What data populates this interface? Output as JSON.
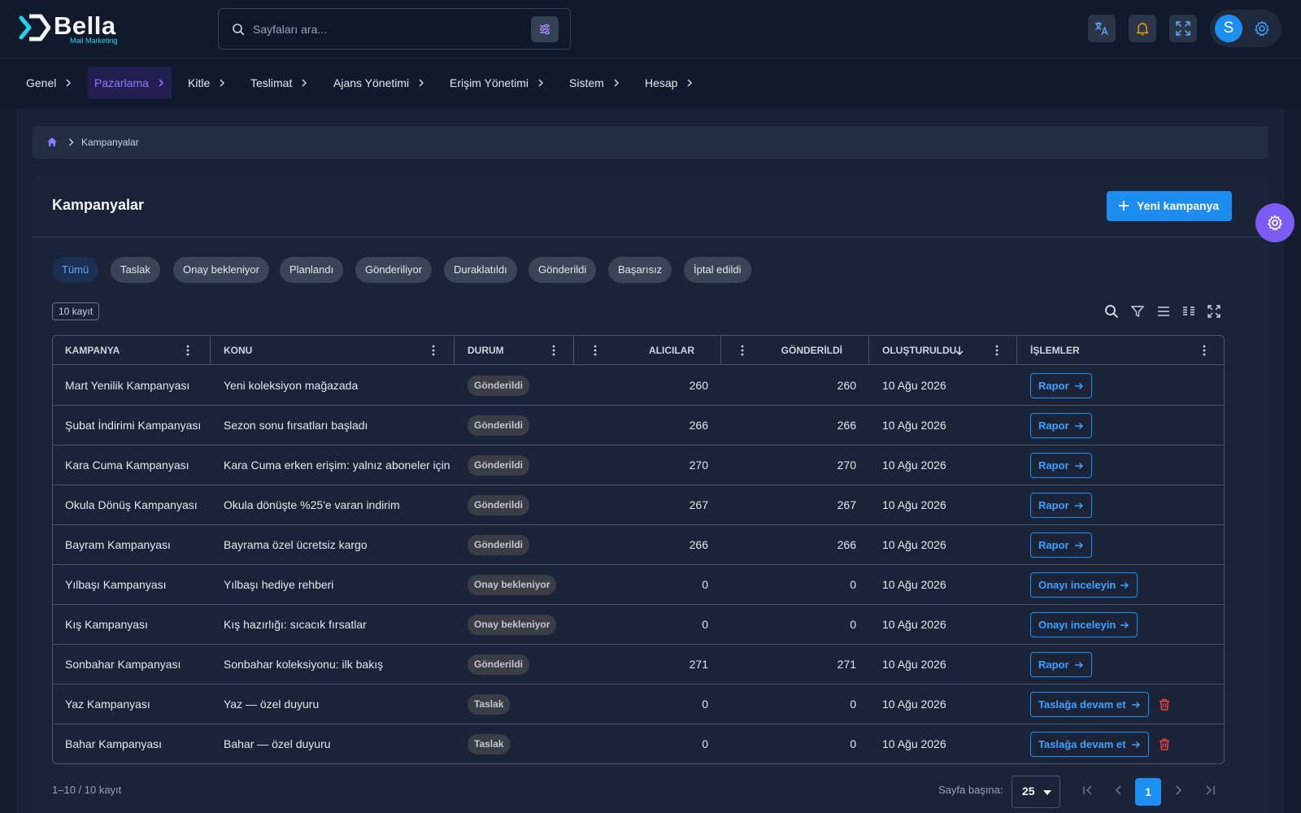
{
  "app": {
    "name": "Bella",
    "subtitle": "Mail Marketing"
  },
  "search": {
    "placeholder": "Sayfaları ara..."
  },
  "menu": [
    {
      "label": "Genel"
    },
    {
      "label": "Pazarlama",
      "active": true
    },
    {
      "label": "Kitle"
    },
    {
      "label": "Teslimat"
    },
    {
      "label": "Ajans Yönetimi"
    },
    {
      "label": "Erişim Yönetimi"
    },
    {
      "label": "Sistem"
    },
    {
      "label": "Hesap"
    }
  ],
  "user": {
    "initial": "S"
  },
  "breadcrumb": {
    "current": "Kampanyalar"
  },
  "page": {
    "title": "Kampanyalar",
    "new_button": "Yeni kampanya"
  },
  "filters": [
    "Tümü",
    "Taslak",
    "Onay bekleniyor",
    "Planlandı",
    "Gönderiliyor",
    "Duraklatıldı",
    "Gönderildi",
    "Başarısız",
    "İptal edildi"
  ],
  "active_filter": "Tümü",
  "record_count": "10 kayıt",
  "table": {
    "columns": [
      "KAMPANYA",
      "KONU",
      "DURUM",
      "ALICILAR",
      "GÖNDERİLDİ",
      "OLUŞTURULDU",
      "İŞLEMLER"
    ],
    "rows": [
      {
        "name": "Mart Yenilik Kampanyası",
        "subject": "Yeni koleksiyon mağazada",
        "status": "Gönderildi",
        "recipients": "260",
        "sent": "260",
        "created": "10 Ağu 2026",
        "action": "Rapor"
      },
      {
        "name": "Şubat İndirimi Kampanyası",
        "subject": "Sezon sonu fırsatları başladı",
        "status": "Gönderildi",
        "recipients": "266",
        "sent": "266",
        "created": "10 Ağu 2026",
        "action": "Rapor"
      },
      {
        "name": "Kara Cuma Kampanyası",
        "subject": "Kara Cuma erken erişim: yalnız aboneler için",
        "status": "Gönderildi",
        "recipients": "270",
        "sent": "270",
        "created": "10 Ağu 2026",
        "action": "Rapor"
      },
      {
        "name": "Okula Dönüş Kampanyası",
        "subject": "Okula dönüşte %25'e varan indirim",
        "status": "Gönderildi",
        "recipients": "267",
        "sent": "267",
        "created": "10 Ağu 2026",
        "action": "Rapor"
      },
      {
        "name": "Bayram Kampanyası",
        "subject": "Bayrama özel ücretsiz kargo",
        "status": "Gönderildi",
        "recipients": "266",
        "sent": "266",
        "created": "10 Ağu 2026",
        "action": "Rapor"
      },
      {
        "name": "Yılbaşı Kampanyası",
        "subject": "Yılbaşı hediye rehberi",
        "status": "Onay bekleniyor",
        "recipients": "0",
        "sent": "0",
        "created": "10 Ağu 2026",
        "action": "Onayı inceleyin"
      },
      {
        "name": "Kış Kampanyası",
        "subject": "Kış hazırlığı: sıcacık fırsatlar",
        "status": "Onay bekleniyor",
        "recipients": "0",
        "sent": "0",
        "created": "10 Ağu 2026",
        "action": "Onayı inceleyin"
      },
      {
        "name": "Sonbahar Kampanyası",
        "subject": "Sonbahar koleksiyonu: ilk bakış",
        "status": "Gönderildi",
        "recipients": "271",
        "sent": "271",
        "created": "10 Ağu 2026",
        "action": "Rapor"
      },
      {
        "name": "Yaz Kampanyası",
        "subject": "Yaz — özel duyuru",
        "status": "Taslak",
        "recipients": "0",
        "sent": "0",
        "created": "10 Ağu 2026",
        "action": "Taslağa devam et",
        "deletable": true
      },
      {
        "name": "Bahar Kampanyası",
        "subject": "Bahar — özel duyuru",
        "status": "Taslak",
        "recipients": "0",
        "sent": "0",
        "created": "10 Ağu 2026",
        "action": "Taslağa devam et",
        "deletable": true
      }
    ]
  },
  "pagination": {
    "range_text": "1–10 / 10 kayıt",
    "per_page_label": "Sayfa başına:",
    "per_page": "25",
    "current_page": "1"
  },
  "colors": {
    "accent": "#1d8ff0",
    "active_menu": "#8b7cff",
    "fab": "#7c5cf5",
    "danger": "#ef4444"
  }
}
